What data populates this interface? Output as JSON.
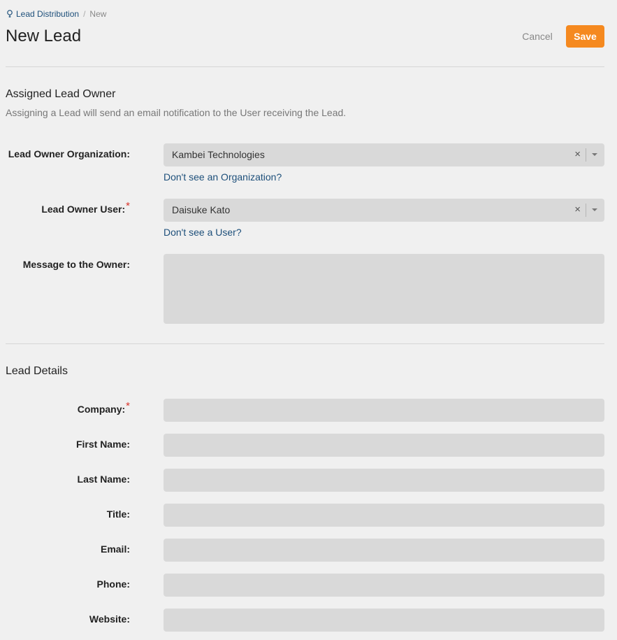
{
  "breadcrumb": {
    "parent": "Lead Distribution",
    "separator": "/",
    "current": "New",
    "icon": "lightbulb-icon"
  },
  "header": {
    "title": "New Lead",
    "cancel_label": "Cancel",
    "save_label": "Save"
  },
  "colors": {
    "accent": "#f5891f",
    "link": "#1d4f7a",
    "required": "#d9342b",
    "input_bg": "#d9d9d9",
    "page_bg": "#f0f0f0"
  },
  "owner_section": {
    "title": "Assigned Lead Owner",
    "description": "Assigning a Lead will send an email notification to the User receiving the Lead.",
    "organization": {
      "label": "Lead Owner Organization:",
      "value": "Kambei Technologies",
      "help_link": "Don't see an Organization?"
    },
    "user": {
      "label": "Lead Owner User:",
      "required_mark": "*",
      "value": "Daisuke Kato",
      "help_link": "Don't see a User?"
    },
    "message": {
      "label": "Message to the Owner:",
      "value": ""
    }
  },
  "details_section": {
    "title": "Lead Details",
    "fields": [
      {
        "label": "Company:",
        "required_mark": "*",
        "value": ""
      },
      {
        "label": "First Name:",
        "value": ""
      },
      {
        "label": "Last Name:",
        "value": ""
      },
      {
        "label": "Title:",
        "value": ""
      },
      {
        "label": "Email:",
        "value": ""
      },
      {
        "label": "Phone:",
        "value": ""
      },
      {
        "label": "Website:",
        "value": ""
      }
    ]
  },
  "icons": {
    "clear": "×",
    "dropdown": "chevron-down-icon"
  }
}
